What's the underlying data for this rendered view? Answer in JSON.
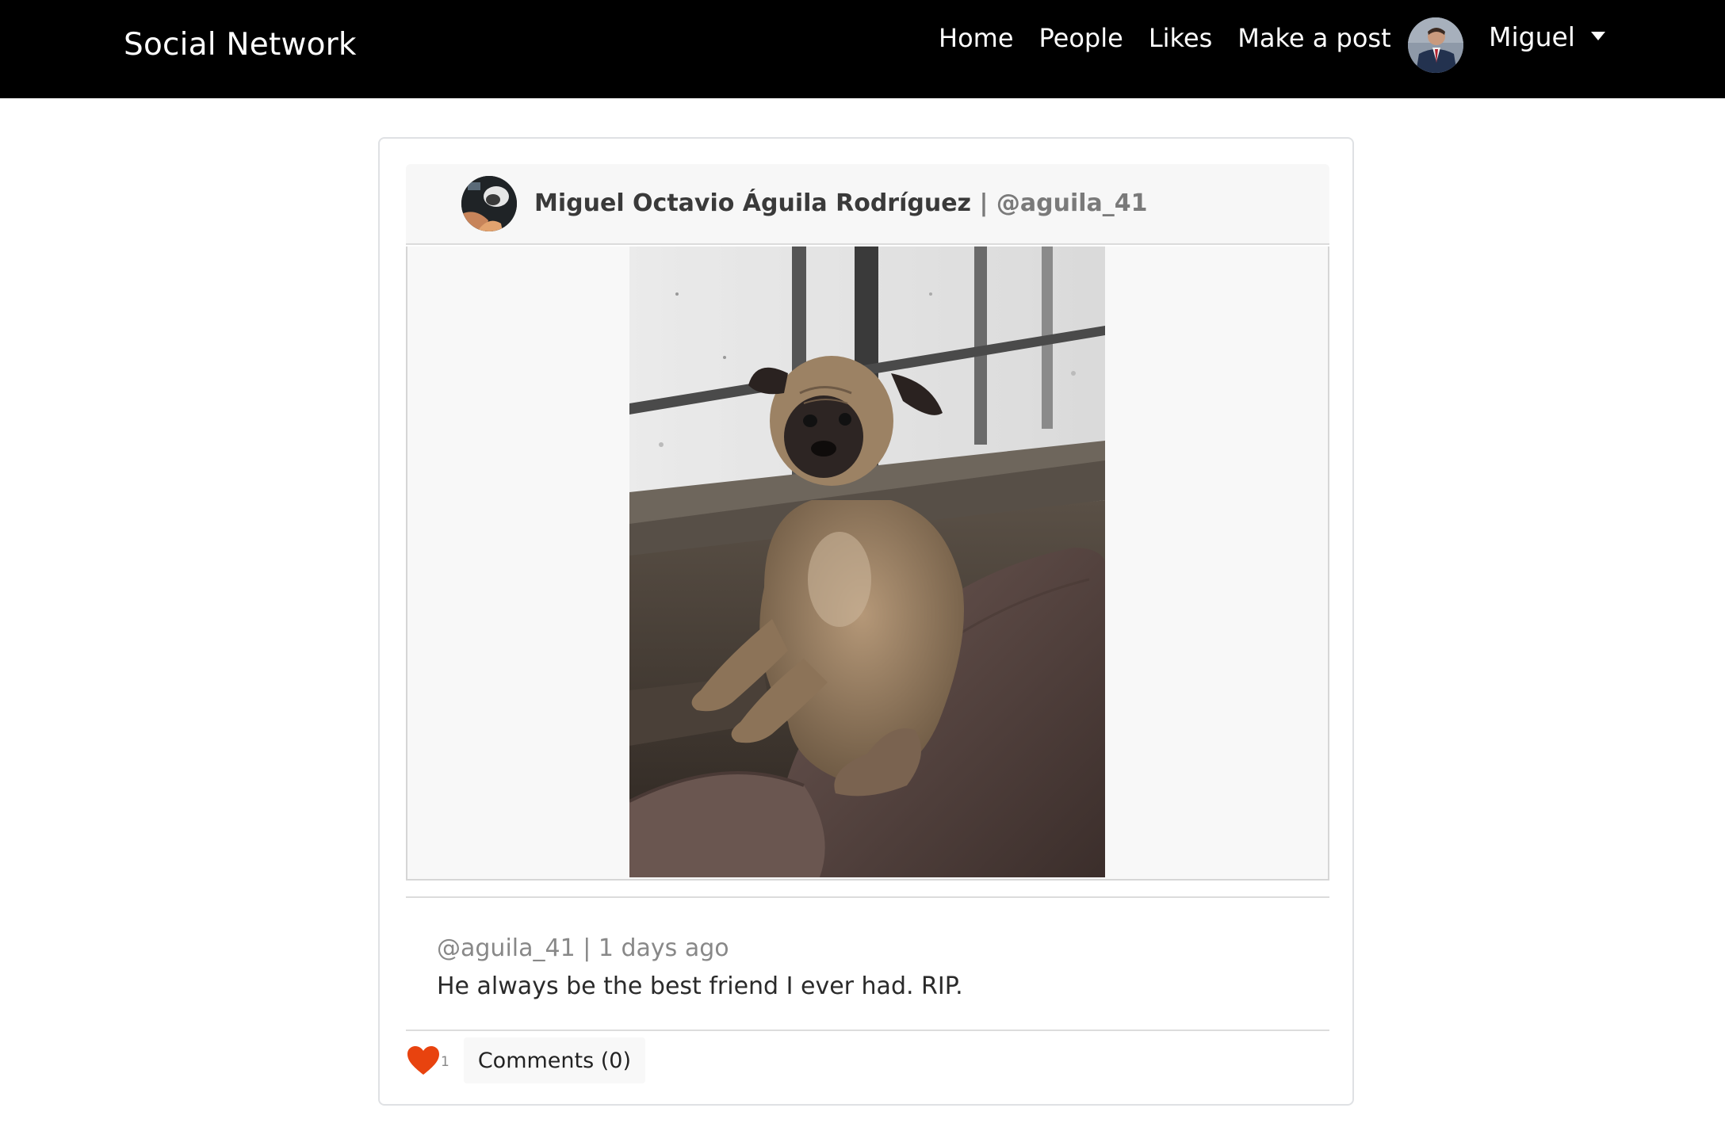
{
  "navbar": {
    "brand": "Social Network",
    "links": [
      {
        "label": "Home"
      },
      {
        "label": "People"
      },
      {
        "label": "Likes"
      },
      {
        "label": "Make a post"
      }
    ],
    "user": {
      "name": "Miguel"
    }
  },
  "post": {
    "author": {
      "full_name": "Miguel Octavio Águila Rodríguez",
      "separator": "|",
      "handle": "@aguila_41"
    },
    "meta": "@aguila_41 | 1 days ago",
    "caption": "He always be the best friend I ever had. RIP.",
    "likes": {
      "count": "1",
      "icon": "heart-icon",
      "color": "#e8430f"
    },
    "comments_label": "Comments (0)"
  }
}
